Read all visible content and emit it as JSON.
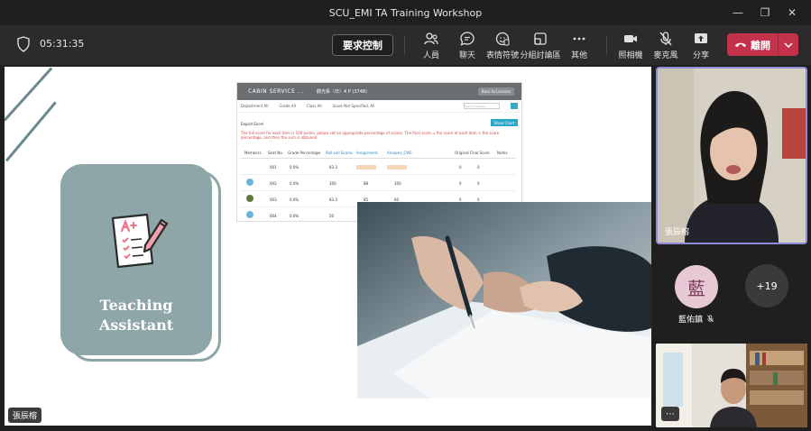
{
  "window": {
    "title": "SCU_EMI TA Training Workshop"
  },
  "toolbar": {
    "timer": "05:31:35",
    "request_control": "要求控制",
    "people": "人員",
    "chat": "聊天",
    "reactions": "表情符號",
    "breakout": "分組討論區",
    "more": "其他",
    "camera": "照相機",
    "mic": "麥克風",
    "share": "分享",
    "leave": "離開"
  },
  "slide": {
    "card_title_line1": "Teaching",
    "card_title_line2": "Assistant",
    "grade_table": {
      "course": "CABIN SERVICE ...",
      "term": "觀光系（日）4 P (3748)",
      "back_button": "Back to Lessons",
      "filters": [
        "Department All",
        "Grade All",
        "Class All",
        "Score Not Specified, All"
      ],
      "search_placeholder": "Search Code by",
      "export": "Export Excel",
      "show_chart": "Show Chart",
      "warning": "The full score for each item is 100 points, please set an appropriate percentage of scores. The final score = the score of each item × the score percentage, and then the sum is obtained.",
      "columns": [
        "Members",
        "Seat No.",
        "Grade Percentage",
        "Roll-call Scores",
        "Assignment",
        "Analysis_CWE",
        "Original",
        "Final Score",
        "Notes"
      ],
      "rows": [
        {
          "seat": "001",
          "pct": "0.0%",
          "roll": "83.3",
          "a": "",
          "b": "",
          "orig": "0",
          "final": "0"
        },
        {
          "seat": "002",
          "pct": "0.0%",
          "roll": "100",
          "a": "88",
          "b": "100",
          "orig": "0",
          "final": "0"
        },
        {
          "seat": "003",
          "pct": "0.0%",
          "roll": "83.3",
          "a": "85",
          "b": "60",
          "orig": "0",
          "final": "0"
        },
        {
          "seat": "004",
          "pct": "0.0%",
          "roll": "50",
          "a": "88",
          "b": "100",
          "orig": "0",
          "final": "0"
        }
      ]
    },
    "presenter_badge": "張辰榕"
  },
  "participants": {
    "speaker_name": "張辰榕",
    "avatar_initial": "藍",
    "avatar_name": "藍佑鎮",
    "overflow_count": "+19"
  },
  "colors": {
    "accent_leave": "#c4314b",
    "card_sage": "#8fa6a8",
    "speaker_border": "#8b8bd8"
  }
}
